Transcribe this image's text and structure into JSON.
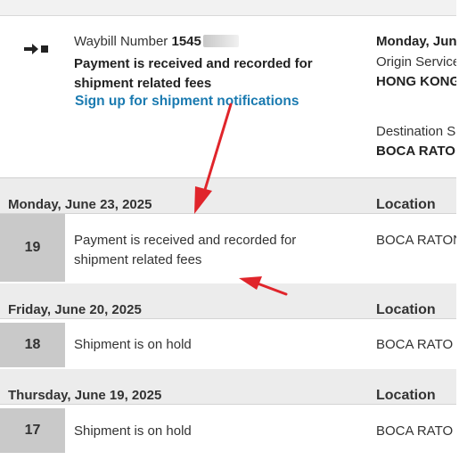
{
  "shipment": {
    "waybill_label": "Waybill Number",
    "waybill_number_visible": "1545",
    "status_title": "Payment is received and recorded for shipment related fees",
    "signup_link": "Sign up for shipment notifications",
    "latest_date": "Monday, Jun",
    "origin_label": "Origin Service",
    "origin_value": "HONG KONG",
    "destination_label": "Destination S",
    "destination_value": "BOCA RATO"
  },
  "groups": [
    {
      "date": "Monday, June 23, 2025",
      "location_header": "Location",
      "events": [
        {
          "number": "19",
          "description": "Payment is received and recorded for shipment related fees",
          "location": "BOCA RATON"
        }
      ]
    },
    {
      "date": "Friday, June 20, 2025",
      "location_header": "Location",
      "events": [
        {
          "number": "18",
          "description": "Shipment is on hold",
          "location": "BOCA RATO"
        }
      ]
    },
    {
      "date": "Thursday, June 19, 2025",
      "location_header": "Location",
      "events": [
        {
          "number": "17",
          "description": "Shipment is on hold",
          "location": "BOCA RATO"
        }
      ]
    }
  ],
  "colors": {
    "link": "#1a7ab0",
    "annotation_arrow": "#e0252b",
    "number_cell": "#c9c9c9",
    "group_header": "#ececec"
  },
  "icons": {
    "status": "arrow-right-square-icon"
  }
}
